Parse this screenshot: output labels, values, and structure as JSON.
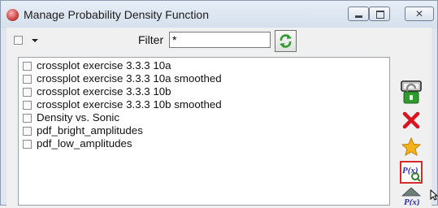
{
  "window": {
    "title": "Manage Probability Density Function"
  },
  "filter": {
    "label": "Filter",
    "value": "*"
  },
  "list": {
    "items": [
      {
        "label": "crossplot exercise 3.3.3 10a"
      },
      {
        "label": "crossplot exercise 3.3.3 10a smoothed"
      },
      {
        "label": "crossplot exercise 3.3.3 10b"
      },
      {
        "label": "crossplot exercise 3.3.3 10b smoothed"
      },
      {
        "label": "Density vs. Sonic"
      },
      {
        "label": "pdf_bright_amplitudes"
      },
      {
        "label": "pdf_low_amplitudes"
      }
    ]
  },
  "side_toolbar": {
    "icons": [
      "new-icon",
      "unlock-icon",
      "delete-icon",
      "favorite-star-icon",
      "pdf-view-icon",
      "pdf-export-icon"
    ],
    "pdf_icon_text": "P(x)"
  },
  "colors": {
    "delete": "#d8141c",
    "star": "#f2b21b",
    "unlock": "#2f9b2f",
    "selected_outline": "#d42a2a"
  }
}
